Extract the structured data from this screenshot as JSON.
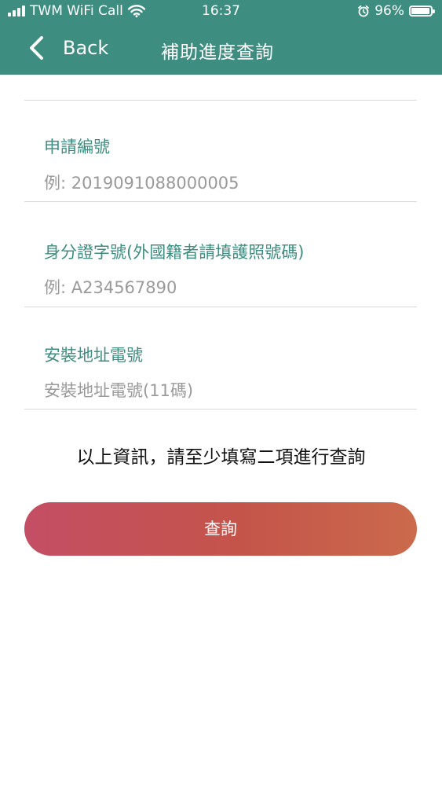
{
  "status_bar": {
    "carrier": "TWM WiFi Call",
    "time": "16:37",
    "battery_text": "96%",
    "battery_level": 0.96,
    "icons": [
      "signal-icon",
      "wifi-icon",
      "alarm-icon",
      "battery-icon"
    ]
  },
  "nav": {
    "back_label": "Back",
    "title": "補助進度查詢"
  },
  "form": {
    "fields": [
      {
        "label": "申請編號",
        "placeholder": "例: 2019091088000005",
        "value": ""
      },
      {
        "label": "身分證字號(外國籍者請填護照號碼)",
        "placeholder": "例: A234567890",
        "value": ""
      },
      {
        "label": "安裝地址電號",
        "placeholder": "安裝地址電號(11碼)",
        "value": ""
      }
    ],
    "note": "以上資訊，請至少填寫二項進行查詢",
    "submit_label": "查詢"
  },
  "colors": {
    "header": "#3d8e80",
    "label": "#3d8e80",
    "button_start": "#c44e64",
    "button_end": "#cb6a4c"
  }
}
